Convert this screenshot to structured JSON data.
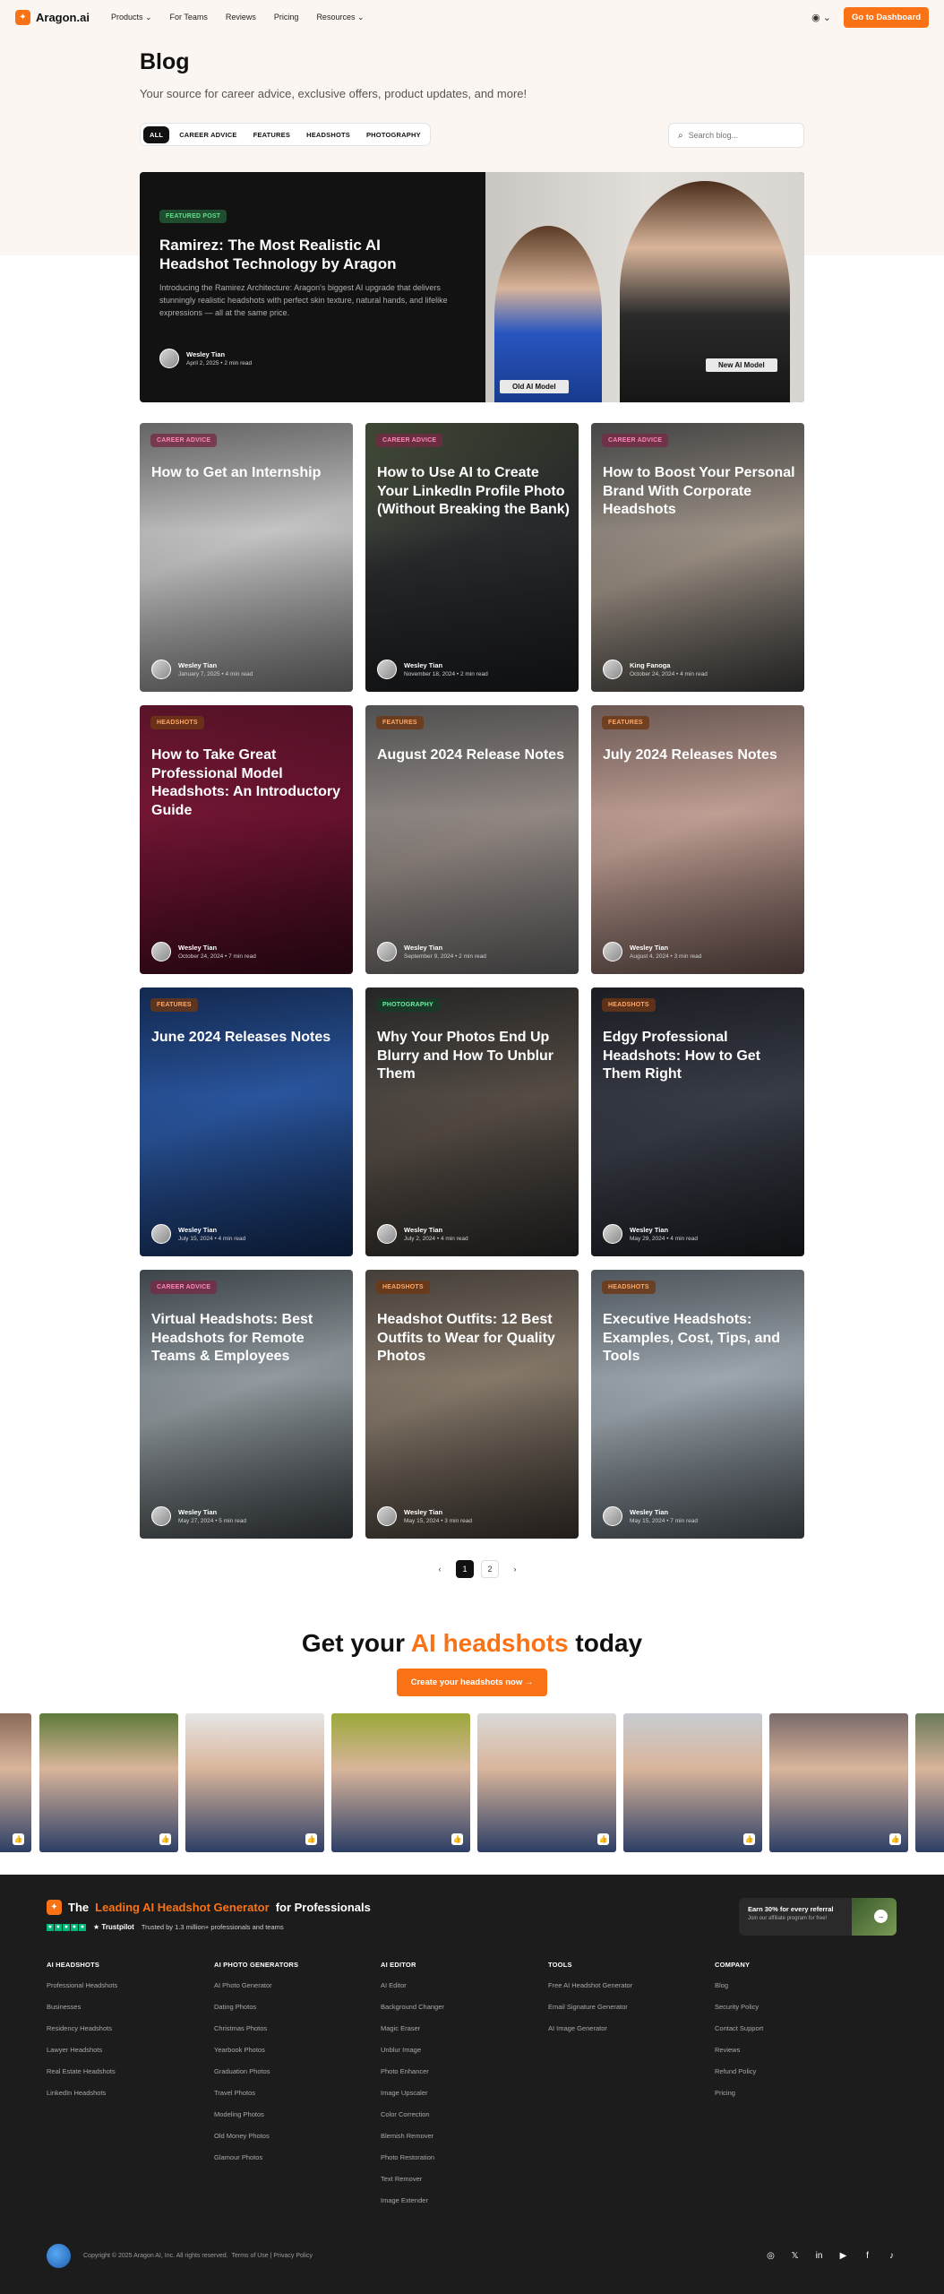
{
  "nav": {
    "brand": "Aragon.ai",
    "links": [
      "Products",
      "For Teams",
      "Reviews",
      "Pricing",
      "Resources"
    ],
    "dashboard_label": "Go to Dashboard"
  },
  "header": {
    "title": "Blog",
    "subtitle": "Your source for career advice, exclusive offers, product updates, and more!",
    "filters": [
      "ALL",
      "CAREER ADVICE",
      "FEATURES",
      "HEADSHOTS",
      "PHOTOGRAPHY"
    ],
    "active_filter": "ALL",
    "search_placeholder": "Search blog..."
  },
  "featured": {
    "badge": "FEATURED POST",
    "title": "Ramirez: The Most Realistic AI Headshot Technology by Aragon",
    "description": "Introducing the Ramirez Architecture: Aragon's biggest AI upgrade that delivers stunningly realistic headshots with perfect skin texture, natural hands, and lifelike expressions — all at the same price.",
    "author": "Wesley Tian",
    "meta": "April 2, 2025 • 2 min read",
    "label_old": "Old AI Model",
    "label_new": "New AI Model"
  },
  "posts": [
    {
      "badge": "CAREER ADVICE",
      "title": "How to Get an Internship",
      "author": "Wesley Tian",
      "meta": "January 7, 2025 • 4 min read"
    },
    {
      "badge": "CAREER ADVICE",
      "title": "How to Use AI to Create Your LinkedIn Profile Photo (Without Breaking the Bank)",
      "author": "Wesley Tian",
      "meta": "November 18, 2024 • 2 min read"
    },
    {
      "badge": "CAREER ADVICE",
      "title": "How to Boost Your Personal Brand With Corporate Headshots",
      "author": "King Fanoga",
      "meta": "October 24, 2024 • 4 min read"
    },
    {
      "badge": "HEADSHOTS",
      "title": "How to Take Great Professional Model Headshots: An Introductory Guide",
      "author": "Wesley Tian",
      "meta": "October 24, 2024 • 7 min read"
    },
    {
      "badge": "FEATURES",
      "title": "August 2024 Release Notes",
      "author": "Wesley Tian",
      "meta": "September 9, 2024 • 2 min read"
    },
    {
      "badge": "FEATURES",
      "title": "July 2024 Releases Notes",
      "author": "Wesley Tian",
      "meta": "August 4, 2024 • 3 min read"
    },
    {
      "badge": "FEATURES",
      "title": "June 2024 Releases Notes",
      "author": "Wesley Tian",
      "meta": "July 15, 2024 • 4 min read"
    },
    {
      "badge": "PHOTOGRAPHY",
      "title": "Why Your Photos End Up Blurry and How To Unblur Them",
      "author": "Wesley Tian",
      "meta": "July 2, 2024 • 4 min read"
    },
    {
      "badge": "HEADSHOTS",
      "title": "Edgy Professional Headshots: How to Get Them Right",
      "author": "Wesley Tian",
      "meta": "May 29, 2024 • 4 min read"
    },
    {
      "badge": "CAREER ADVICE",
      "title": "Virtual Headshots: Best Headshots for Remote Teams & Employees",
      "author": "Wesley Tian",
      "meta": "May 27, 2024 • 5 min read"
    },
    {
      "badge": "HEADSHOTS",
      "title": "Headshot Outfits: 12 Best Outfits to Wear for Quality Photos",
      "author": "Wesley Tian",
      "meta": "May 15, 2024 • 3 min read"
    },
    {
      "badge": "HEADSHOTS",
      "title": "Executive Headshots: Examples, Cost, Tips, and Tools",
      "author": "Wesley Tian",
      "meta": "May 15, 2024 • 7 min read"
    }
  ],
  "pagination": {
    "pages": [
      "1",
      "2"
    ],
    "current": "1"
  },
  "cta": {
    "title_before": "Get your",
    "title_highlight": "AI headshots",
    "title_after": "today",
    "button": "Create your headshots now →"
  },
  "footer": {
    "brand_before": "The",
    "brand_highlight": "Leading AI Headshot Generator",
    "brand_after": "for Professionals",
    "trustpilot": "Trustpilot",
    "trusted": "Trusted by 1.3 million+ professionals and teams",
    "referral_title": "Earn 30% for every referral",
    "referral_sub": "Join our affiliate program for free!",
    "columns": [
      {
        "heading": "AI HEADSHOTS",
        "links": [
          "Professional Headshots",
          "Businesses",
          "Residency Headshots",
          "Lawyer Headshots",
          "Real Estate Headshots",
          "LinkedIn Headshots"
        ]
      },
      {
        "heading": "AI PHOTO GENERATORS",
        "links": [
          "AI Photo Generator",
          "Dating Photos",
          "Christmas Photos",
          "Yearbook Photos",
          "Graduation Photos",
          "Travel Photos",
          "Modeling Photos",
          "Old Money Photos",
          "Glamour Photos"
        ]
      },
      {
        "heading": "AI EDITOR",
        "links": [
          "AI Editor",
          "Background Changer",
          "Magic Eraser",
          "Unblur Image",
          "Photo Enhancer",
          "Image Upscaler",
          "Color Correction",
          "Blemish Remover",
          "Photo Restoration",
          "Text Remover",
          "Image Extender"
        ]
      },
      {
        "heading": "TOOLS",
        "links": [
          "Free AI Headshot Generator",
          "Email Signature Generator",
          "AI Image Generator"
        ]
      },
      {
        "heading": "COMPANY",
        "links": [
          "Blog",
          "Security Policy",
          "Contact Support",
          "Reviews",
          "Refund Policy",
          "Pricing"
        ]
      }
    ],
    "copyright": "Copyright © 2025 Aragon AI, Inc. All rights reserved.",
    "terms": "Terms of Use",
    "privacy": "Privacy Policy",
    "socials": [
      "instagram-icon",
      "twitter-icon",
      "linkedin-icon",
      "youtube-icon",
      "facebook-icon",
      "tiktok-icon"
    ]
  },
  "colors": {
    "accent": "#f97316",
    "dark": "#111111",
    "footer_bg": "#1c1c1c"
  }
}
